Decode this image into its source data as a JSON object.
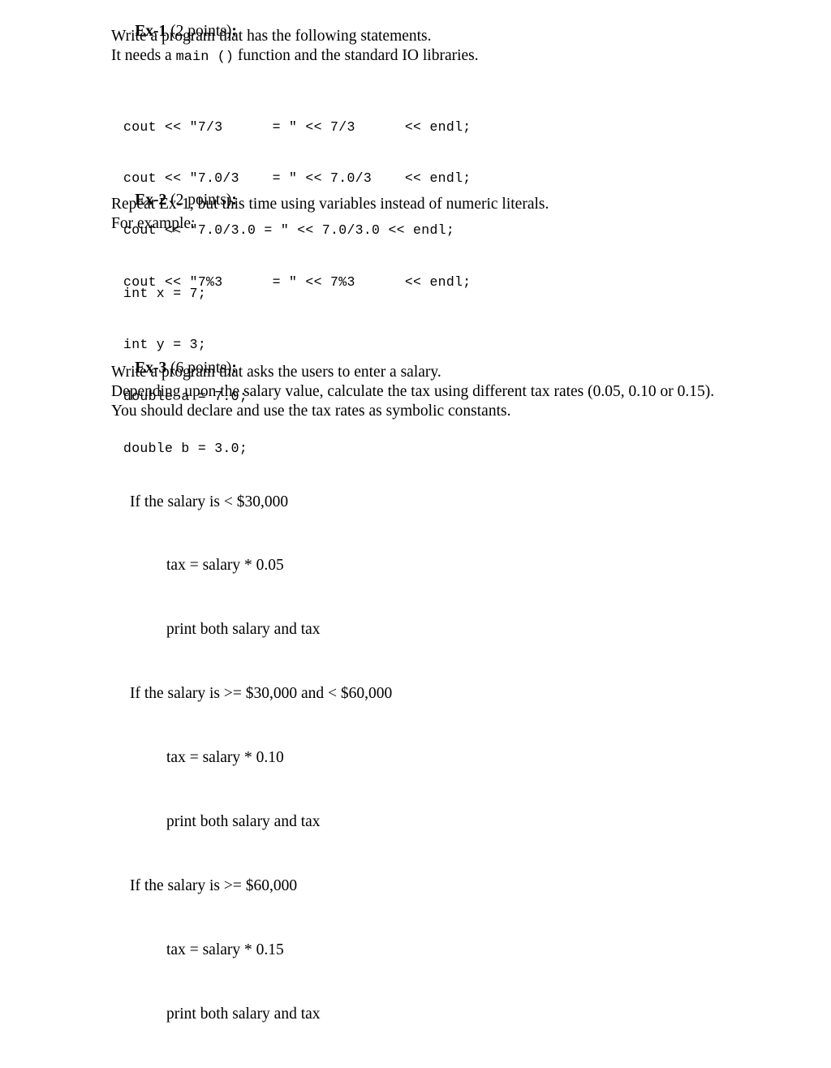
{
  "document": {
    "background_color": "#ffffff",
    "text_color": "#000000"
  },
  "exercises": [
    {
      "label": "Ex-1",
      "points": " (2 points)",
      "colon": ":",
      "body": [
        "Write a program that has the following statements.",
        "It needs a "
      ],
      "inline_code": "main ()",
      "body_tail": " function and the standard IO libraries.",
      "code": [
        "cout << \"7/3      = \" << 7/3      << endl;",
        "cout << \"7.0/3    = \" << 7.0/3    << endl;",
        "cout << \"7.0/3.0 = \" << 7.0/3.0 << endl;",
        "cout << \"7%3      = \" << 7%3      << endl;"
      ]
    },
    {
      "label": "Ex-2",
      "points": " (2 points)",
      "colon": ":",
      "body": [
        "Repeat Ex-1, but this time using variables instead of numeric literals.",
        "For example:"
      ],
      "code": [
        "int x = 7;",
        "int y = 3;",
        "double a = 7.0;",
        "double b = 3.0;"
      ]
    },
    {
      "label": "Ex-3",
      "points": " (6 points)",
      "colon": ":",
      "body": [
        "Write a program that asks the users to enter a salary.",
        "Depending upon the salary value, calculate the tax using different tax rates (0.05, 0.10 or 0.15).",
        "You should declare and use the tax rates as symbolic constants."
      ],
      "pseudocode": [
        {
          "text": "If the salary is < $30,000",
          "indent": 0
        },
        {
          "text": "tax = salary * 0.05",
          "indent": 1
        },
        {
          "text": "print both salary and tax",
          "indent": 1
        },
        {
          "text": "If the salary is >= $30,000 and < $60,000",
          "indent": 0
        },
        {
          "text": "tax = salary * 0.10",
          "indent": 1
        },
        {
          "text": "print both salary and tax",
          "indent": 1
        },
        {
          "text": "If the salary is >= $60,000",
          "indent": 0
        },
        {
          "text": "tax = salary * 0.15",
          "indent": 1
        },
        {
          "text": "print both salary and tax",
          "indent": 1
        }
      ]
    }
  ]
}
